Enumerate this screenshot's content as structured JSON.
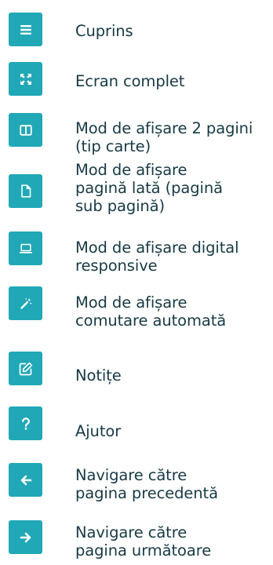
{
  "legend": {
    "items": [
      {
        "icon": "list-icon",
        "label": "Cuprins"
      },
      {
        "icon": "fullscreen-icon",
        "label": "Ecran complet"
      },
      {
        "icon": "two-page-view-icon",
        "label": "Mod de afișare 2 pagini\n(tip carte)"
      },
      {
        "icon": "page-icon",
        "label": "Mod de afișare\npagină lată (pagină\nsub pagină)"
      },
      {
        "icon": "laptop-icon",
        "label": "Mod de afișare digital\nresponsive"
      },
      {
        "icon": "magic-wand-icon",
        "label": "Mod de afișare\ncomutare automată"
      },
      {
        "icon": "edit-note-icon",
        "label": "Notițe"
      },
      {
        "icon": "question-icon",
        "label": "Ajutor"
      },
      {
        "icon": "arrow-left-icon",
        "label": "Navigare către\npagina precedentă"
      },
      {
        "icon": "arrow-right-icon",
        "label": "Navigare către\npagina următoare"
      }
    ]
  },
  "colors": {
    "button_bg": "#20a8b6",
    "icon_fg": "#ffffff",
    "text": "#173a44"
  }
}
